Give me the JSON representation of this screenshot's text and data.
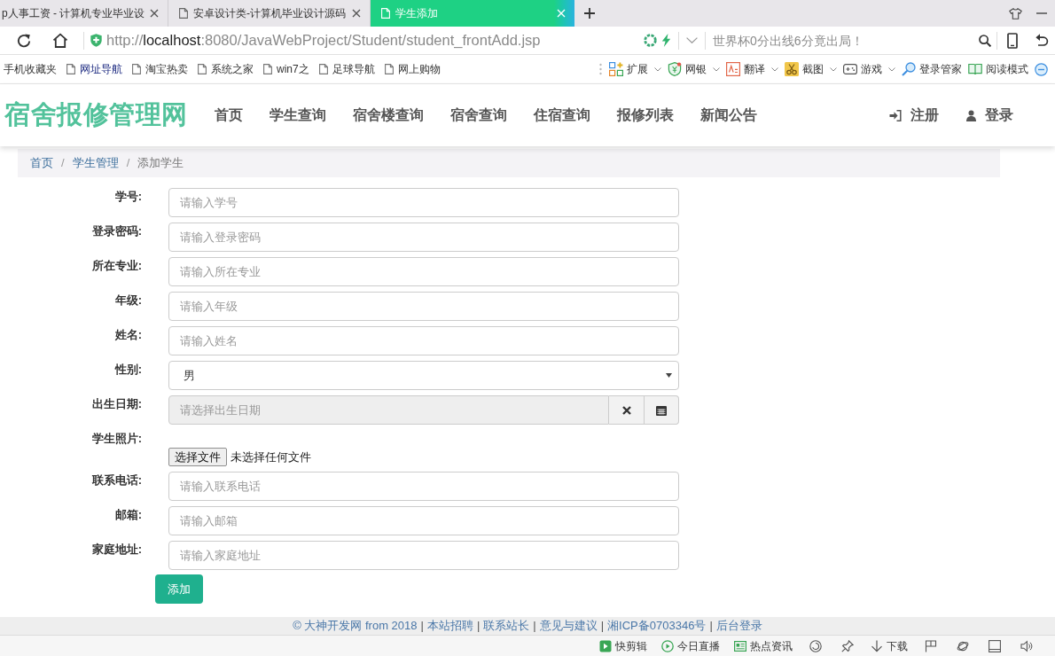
{
  "browser": {
    "tabs": [
      {
        "title": "p人事工资 - 计算机专业毕业设",
        "icon": false,
        "selected": false
      },
      {
        "title": "安卓设计类-计算机毕业设计源码",
        "icon": true,
        "selected": false
      },
      {
        "title": "学生添加",
        "icon": true,
        "selected": true
      }
    ],
    "address_bar": {
      "scheme": "http://",
      "host": "localhost",
      "path": ":8080/JavaWebProject/Student/student_frontAdd.jsp"
    },
    "search": {
      "placeholder": "世界杯0分出线6分竟出局！"
    },
    "bookmarks": [
      {
        "label": "手机收藏夹",
        "icon": false,
        "featured": false
      },
      {
        "label": "网址导航",
        "icon": true,
        "featured": true
      },
      {
        "label": "淘宝热卖",
        "icon": true,
        "featured": false
      },
      {
        "label": "系统之家",
        "icon": true,
        "featured": false
      },
      {
        "label": "win7之",
        "icon": true,
        "featured": false
      },
      {
        "label": "足球导航",
        "icon": true,
        "featured": false
      },
      {
        "label": "网上购物",
        "icon": true,
        "featured": false
      }
    ],
    "tools": [
      {
        "kind": "extensions",
        "label": "扩展",
        "dropdown": true
      },
      {
        "kind": "bank",
        "label": "网银",
        "dropdown": true
      },
      {
        "kind": "translate",
        "label": "翻译",
        "dropdown": true
      },
      {
        "kind": "screenshot",
        "label": "截图",
        "dropdown": true
      },
      {
        "kind": "games",
        "label": "游戏",
        "dropdown": true
      },
      {
        "kind": "login",
        "label": "登录管家",
        "dropdown": false
      },
      {
        "kind": "reader",
        "label": "阅读模式",
        "dropdown": false
      }
    ]
  },
  "site": {
    "brand": "宿舍报修管理网",
    "nav": [
      "首页",
      "学生查询",
      "宿舍楼查询",
      "宿舍查询",
      "住宿查询",
      "报修列表",
      "新闻公告"
    ],
    "account": [
      {
        "kind": "register",
        "label": "注册"
      },
      {
        "kind": "login",
        "label": "登录"
      }
    ]
  },
  "breadcrumb": [
    {
      "kind": "link",
      "text": "首页"
    },
    {
      "kind": "separator",
      "text": "/"
    },
    {
      "kind": "link",
      "text": "学生管理"
    },
    {
      "kind": "separator",
      "text": "/"
    },
    {
      "kind": "current",
      "text": "添加学生"
    }
  ],
  "form": {
    "fields": [
      {
        "kind": "text",
        "label": "学号:",
        "placeholder": "请输入学号",
        "disabled": false
      },
      {
        "kind": "text",
        "label": "登录密码:",
        "placeholder": "请输入登录密码",
        "disabled": false
      },
      {
        "kind": "text",
        "label": "所在专业:",
        "placeholder": "请输入所在专业",
        "disabled": false
      },
      {
        "kind": "text",
        "label": "年级:",
        "placeholder": "请输入年级",
        "disabled": false
      },
      {
        "kind": "text",
        "label": "姓名:",
        "placeholder": "请输入姓名",
        "disabled": false
      },
      {
        "kind": "select",
        "label": "性别:",
        "value": "男",
        "disabled": false
      },
      {
        "kind": "date",
        "label": "出生日期:",
        "placeholder": "请选择出生日期",
        "disabled": true
      },
      {
        "kind": "file",
        "label": "学生照片:",
        "button": "选择文件",
        "status": "未选择任何文件",
        "disabled": false
      },
      {
        "kind": "text",
        "label": "联系电话:",
        "placeholder": "请输入联系电话",
        "disabled": false
      },
      {
        "kind": "text",
        "label": "邮箱:",
        "placeholder": "请输入邮箱",
        "disabled": false
      },
      {
        "kind": "text",
        "label": "家庭地址:",
        "placeholder": "请输入家庭地址",
        "disabled": false
      }
    ],
    "submit": "添加"
  },
  "footer": [
    {
      "kind": "link",
      "text": "© 大神开发网 from 2018"
    },
    {
      "kind": "separator",
      "text": "|"
    },
    {
      "kind": "link",
      "text": "本站招聘"
    },
    {
      "kind": "separator",
      "text": "|"
    },
    {
      "kind": "link",
      "text": "联系站长"
    },
    {
      "kind": "separator",
      "text": "|"
    },
    {
      "kind": "link",
      "text": "意见与建议"
    },
    {
      "kind": "separator",
      "text": "|"
    },
    {
      "kind": "link",
      "text": "湘ICP备0703346号"
    },
    {
      "kind": "separator",
      "text": "|"
    },
    {
      "kind": "link",
      "text": "后台登录"
    }
  ],
  "status_bar": [
    {
      "kind": "clip",
      "label": "快剪辑"
    },
    {
      "kind": "live",
      "label": "今日直播"
    },
    {
      "kind": "news",
      "label": "热点资讯"
    },
    {
      "kind": "spiral"
    },
    {
      "kind": "pin"
    },
    {
      "kind": "download",
      "label": "下载"
    },
    {
      "kind": "flag"
    },
    {
      "kind": "ring"
    },
    {
      "kind": "window"
    },
    {
      "kind": "speaker"
    }
  ]
}
